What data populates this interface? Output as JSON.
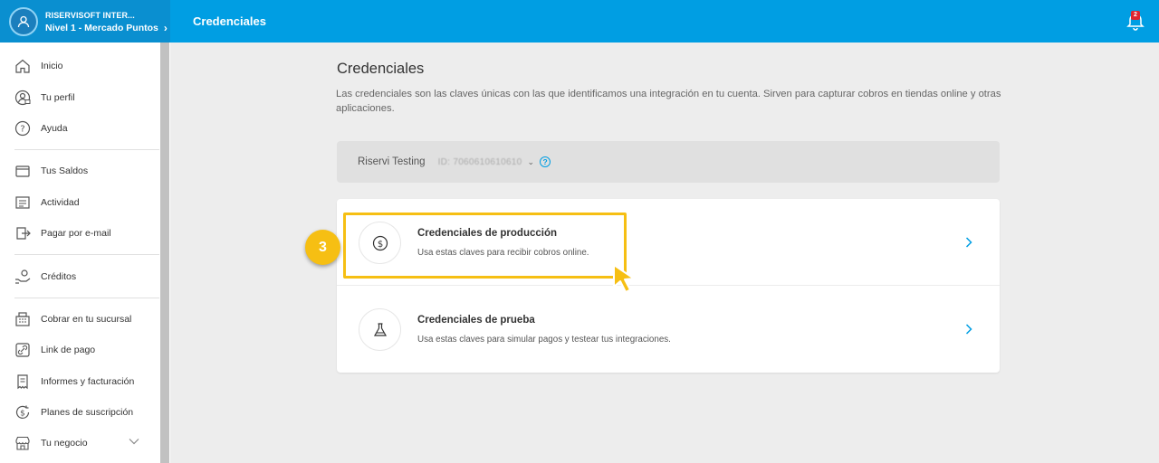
{
  "header": {
    "account_name": "RISERVISOFT INTER...",
    "account_level": "Nivel 1 - Mercado Puntos",
    "page_title": "Credenciales",
    "notifications_count": "2"
  },
  "sidebar": {
    "items": [
      {
        "label": "Inicio",
        "icon": "home-icon"
      },
      {
        "label": "Tu perfil",
        "icon": "profile-icon"
      },
      {
        "label": "Ayuda",
        "icon": "help-icon"
      },
      {
        "label": "Tus Saldos",
        "icon": "wallet-icon"
      },
      {
        "label": "Actividad",
        "icon": "activity-icon"
      },
      {
        "label": "Pagar por e-mail",
        "icon": "send-icon"
      },
      {
        "label": "Créditos",
        "icon": "credit-icon"
      },
      {
        "label": "Cobrar en tu sucursal",
        "icon": "register-icon"
      },
      {
        "label": "Link de pago",
        "icon": "link-icon"
      },
      {
        "label": "Informes y facturación",
        "icon": "receipt-icon"
      },
      {
        "label": "Planes de suscripción",
        "icon": "subscription-icon"
      },
      {
        "label": "Tu negocio",
        "icon": "store-icon"
      }
    ]
  },
  "main": {
    "title": "Credenciales",
    "description": "Las credenciales son las claves únicas con las que identificamos una integración en tu cuenta. Sirven para capturar cobros en tiendas online y otras aplicaciones.",
    "application": {
      "name": "Riservi Testing",
      "id": "ID: 7060610610610",
      "help": "?"
    },
    "options": [
      {
        "title": "Credenciales de producción",
        "subtitle": "Usa estas claves para recibir cobros online.",
        "icon": "dollar-icon"
      },
      {
        "title": "Credenciales de prueba",
        "subtitle": "Usa estas claves para simular pagos y testear tus integraciones.",
        "icon": "flask-icon"
      }
    ]
  },
  "annotation": {
    "step_number": "3",
    "color": "#f6bf13"
  },
  "colors": {
    "brand": "#009ee3",
    "accent": "#f6bf13"
  }
}
